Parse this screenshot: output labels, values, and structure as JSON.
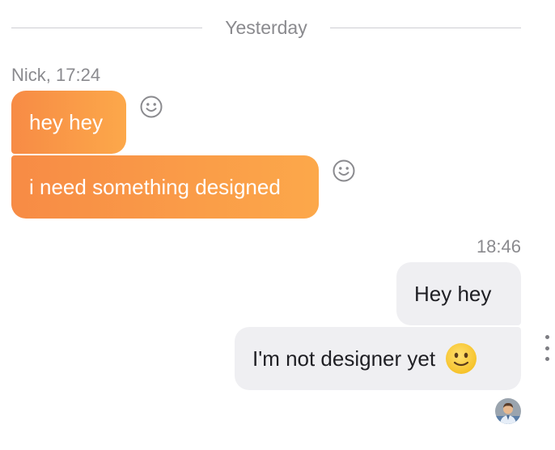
{
  "divider": {
    "label": "Yesterday"
  },
  "incoming": {
    "sender": "Nick, 17:24",
    "messages": [
      {
        "text": "hey hey"
      },
      {
        "text": "i need something designed"
      }
    ],
    "reaction_icon": "smiley-outline-icon"
  },
  "outgoing": {
    "time": "18:46",
    "messages": [
      {
        "text": "Hey hey"
      },
      {
        "text": "I'm not designer yet",
        "emoji": "slightly-smiling-face-emoji"
      }
    ],
    "avatar": "user-avatar"
  },
  "menu_icon": "vertical-ellipsis-icon",
  "colors": {
    "incoming_gradient_start": "#f78b45",
    "incoming_gradient_end": "#fca84a",
    "outgoing_bubble": "#efeff2",
    "meta_text": "#8a8a8e",
    "emoji_yellow": "#fbd13b"
  }
}
